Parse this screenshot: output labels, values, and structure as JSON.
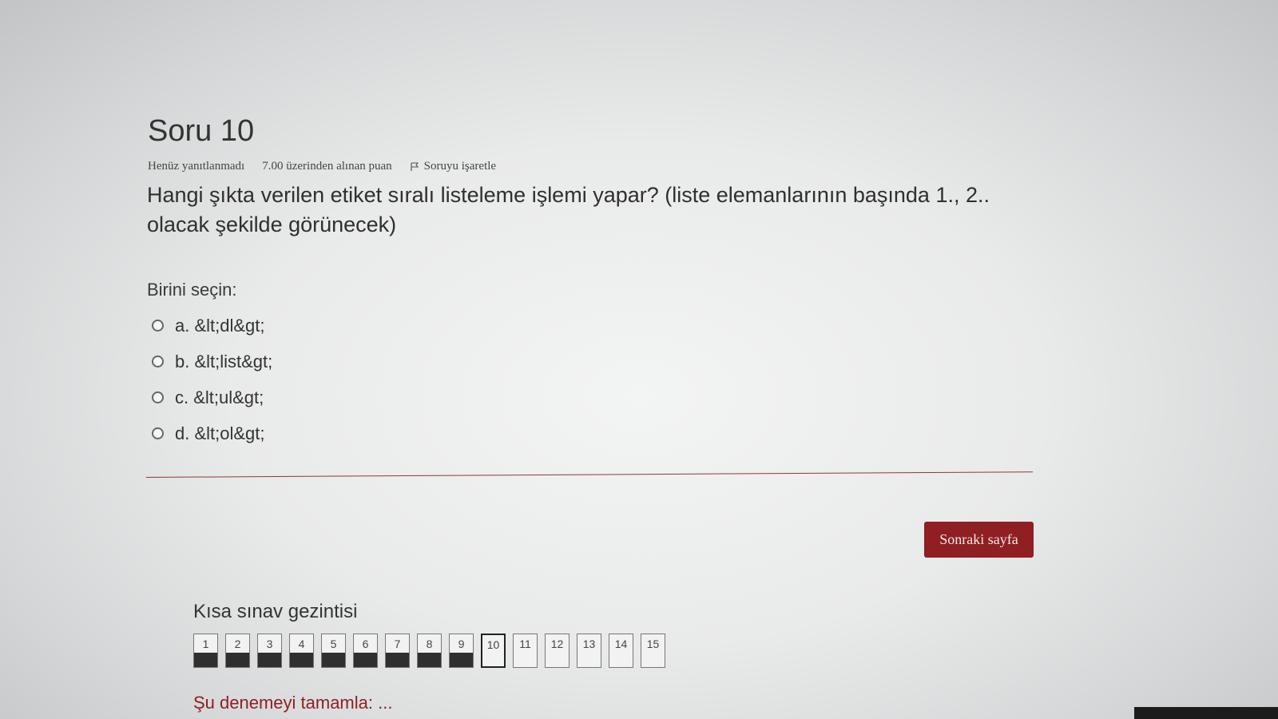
{
  "question": {
    "title": "Soru 10",
    "status": "Henüz yanıtlanmadı",
    "points": "7.00 üzerinden alınan puan",
    "flag_label": "Soruyu işaretle",
    "text": "Hangi şıkta verilen etiket sıralı listeleme işlemi yapar? (liste elemanlarının başında 1., 2.. olacak şekilde görünecek)",
    "prompt": "Birini seçin:",
    "options": [
      {
        "label": "a. &lt;dl&gt;"
      },
      {
        "label": "b. &lt;list&gt;"
      },
      {
        "label": "c. &lt;ul&gt;"
      },
      {
        "label": "d. &lt;ol&gt;"
      }
    ]
  },
  "actions": {
    "next_label": "Sonraki sayfa"
  },
  "nav": {
    "title": "Kısa sınav gezintisi",
    "items": [
      {
        "label": "1",
        "state": "answered"
      },
      {
        "label": "2",
        "state": "answered"
      },
      {
        "label": "3",
        "state": "answered"
      },
      {
        "label": "4",
        "state": "answered"
      },
      {
        "label": "5",
        "state": "answered"
      },
      {
        "label": "6",
        "state": "answered"
      },
      {
        "label": "7",
        "state": "answered"
      },
      {
        "label": "8",
        "state": "answered"
      },
      {
        "label": "9",
        "state": "answered"
      },
      {
        "label": "10",
        "state": "current"
      },
      {
        "label": "11",
        "state": "unanswered"
      },
      {
        "label": "12",
        "state": "unanswered"
      },
      {
        "label": "13",
        "state": "unanswered"
      },
      {
        "label": "14",
        "state": "unanswered"
      },
      {
        "label": "15",
        "state": "unanswered"
      }
    ],
    "finish_label": "Şu denemeyi tamamla: ..."
  },
  "colors": {
    "accent": "#8f1f22",
    "answered_fill": "#2f2f2f"
  },
  "icons": {
    "flag": "flag-icon",
    "radio": "radio-icon"
  }
}
